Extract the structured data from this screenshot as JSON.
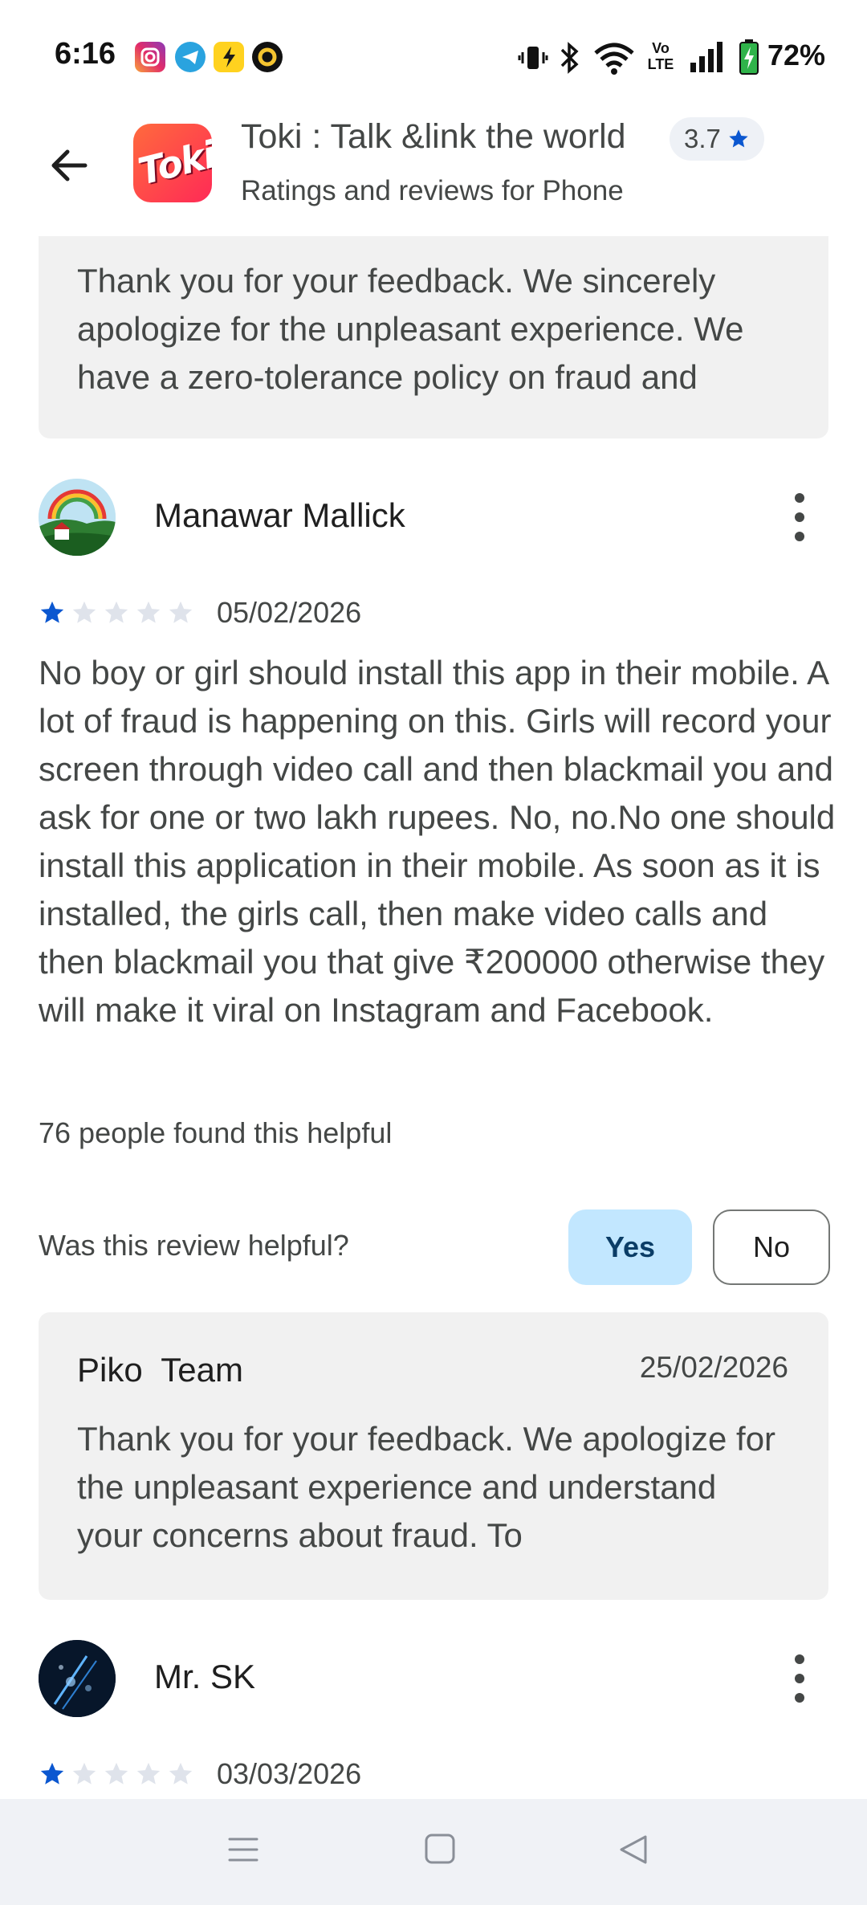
{
  "status_bar": {
    "time": "6:16",
    "battery": "72%",
    "network": "Vo LTE"
  },
  "header": {
    "app_title": "Toki : Talk &link the world",
    "subtitle": "Ratings and reviews for Phone",
    "rating": "3.7",
    "app_icon_text": "Toki"
  },
  "reply_top": {
    "text": "Thank you for your feedback. We sincerely apologize for the unpleasant experience. We have a zero-tolerance policy on fraud and"
  },
  "review1": {
    "author": "Manawar Mallick",
    "stars": 1,
    "date": "05/02/2026",
    "body": "No boy or girl should install this app in their mobile. A lot of fraud is happening on this. Girls will record your screen through video call and then blackmail you and ask for one or two lakh rupees. No, no.No one should install this application in their mobile. As soon as it is installed, the girls call, then make video calls and then blackmail you that give ₹200000 otherwise they will make it viral on Instagram and Facebook.",
    "helpful_count": "76 people found this helpful",
    "helpful_question": "Was this review helpful?",
    "yes_label": "Yes",
    "no_label": "No"
  },
  "reply1": {
    "author": "Piko  Team",
    "date": "25/02/2026",
    "text": "Thank you for your feedback. We apologize for the unpleasant experience and understand your concerns about fraud. To"
  },
  "review2": {
    "author": "Mr. SK",
    "stars": 1,
    "date": "03/03/2026"
  },
  "colors": {
    "star_filled": "#0b57d0",
    "star_empty": "#dfe3eb",
    "yes_bg": "#c2e7ff",
    "card_bg": "#f1f1f1"
  }
}
